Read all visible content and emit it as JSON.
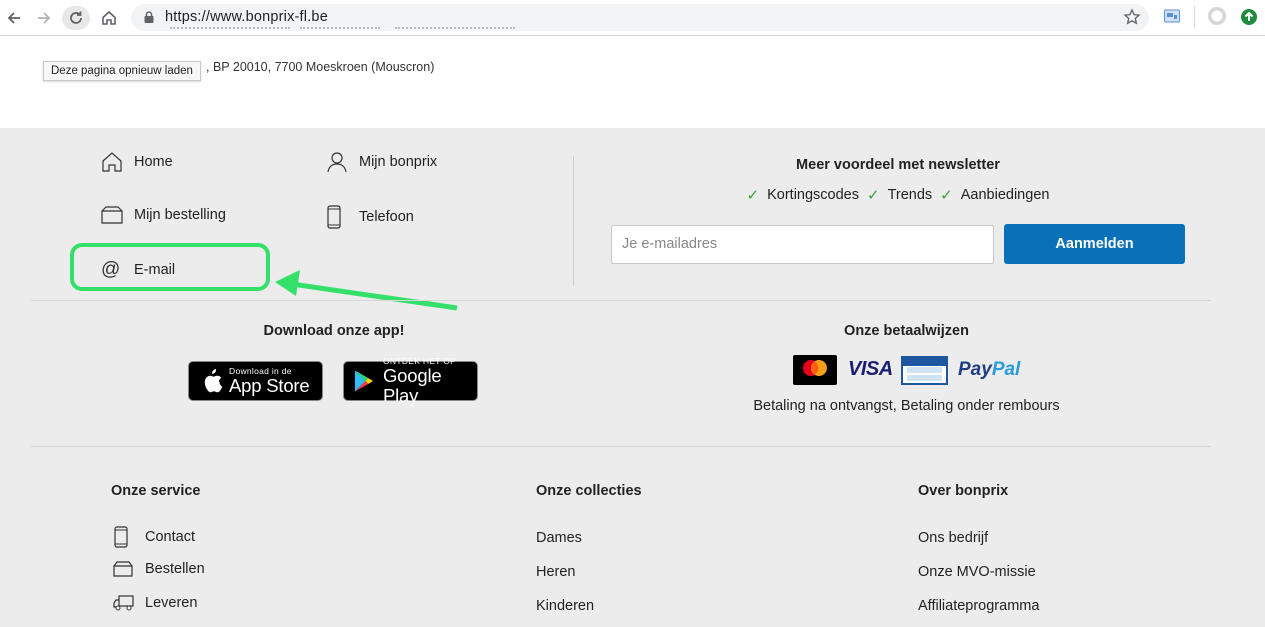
{
  "browser": {
    "url": "https://www.bonprix-fl.be",
    "tooltip": "Deze pagina opnieuw laden"
  },
  "page": {
    "address_fragment": ", BP 20010, 7700 Moeskroen (Mouscron)"
  },
  "quicklinks": {
    "home": "Home",
    "mijn_bonprix": "Mijn bonprix",
    "mijn_bestelling": "Mijn bestelling",
    "telefoon": "Telefoon",
    "email": "E-mail"
  },
  "newsletter": {
    "title": "Meer voordeel met newsletter",
    "points": [
      "Kortingscodes",
      "Trends",
      "Aanbiedingen"
    ],
    "email_placeholder": "Je e-mailadres",
    "submit_label": "Aanmelden"
  },
  "app": {
    "title": "Download onze app!",
    "appstore_small": "Download in de",
    "appstore_big": "App Store",
    "googleplay_small": "ONTDEK HET OP",
    "googleplay_big": "Google Play"
  },
  "payment": {
    "title": "Onze betaalwijzen",
    "logos": [
      "mastercard",
      "VISA",
      "Bancontact Mister Cash",
      "PayPal"
    ],
    "visa": "VISA",
    "paypal_pay": "Pay",
    "paypal_pal": "Pal",
    "note": "Betaling na ontvangst, Betaling onder rembours"
  },
  "columns": {
    "service": {
      "title": "Onze service",
      "items": [
        "Contact",
        "Bestellen",
        "Leveren"
      ]
    },
    "collecties": {
      "title": "Onze collecties",
      "items": [
        "Dames",
        "Heren",
        "Kinderen"
      ]
    },
    "over": {
      "title": "Over bonprix",
      "items": [
        "Ons bedrijf",
        "Onze MVO-missie",
        "Affiliateprogramma"
      ]
    }
  },
  "colors": {
    "accent_blue": "#0a71b8",
    "annotation_green": "#35e06a",
    "check_green": "#3aa33a",
    "footer_bg": "#ececec"
  }
}
